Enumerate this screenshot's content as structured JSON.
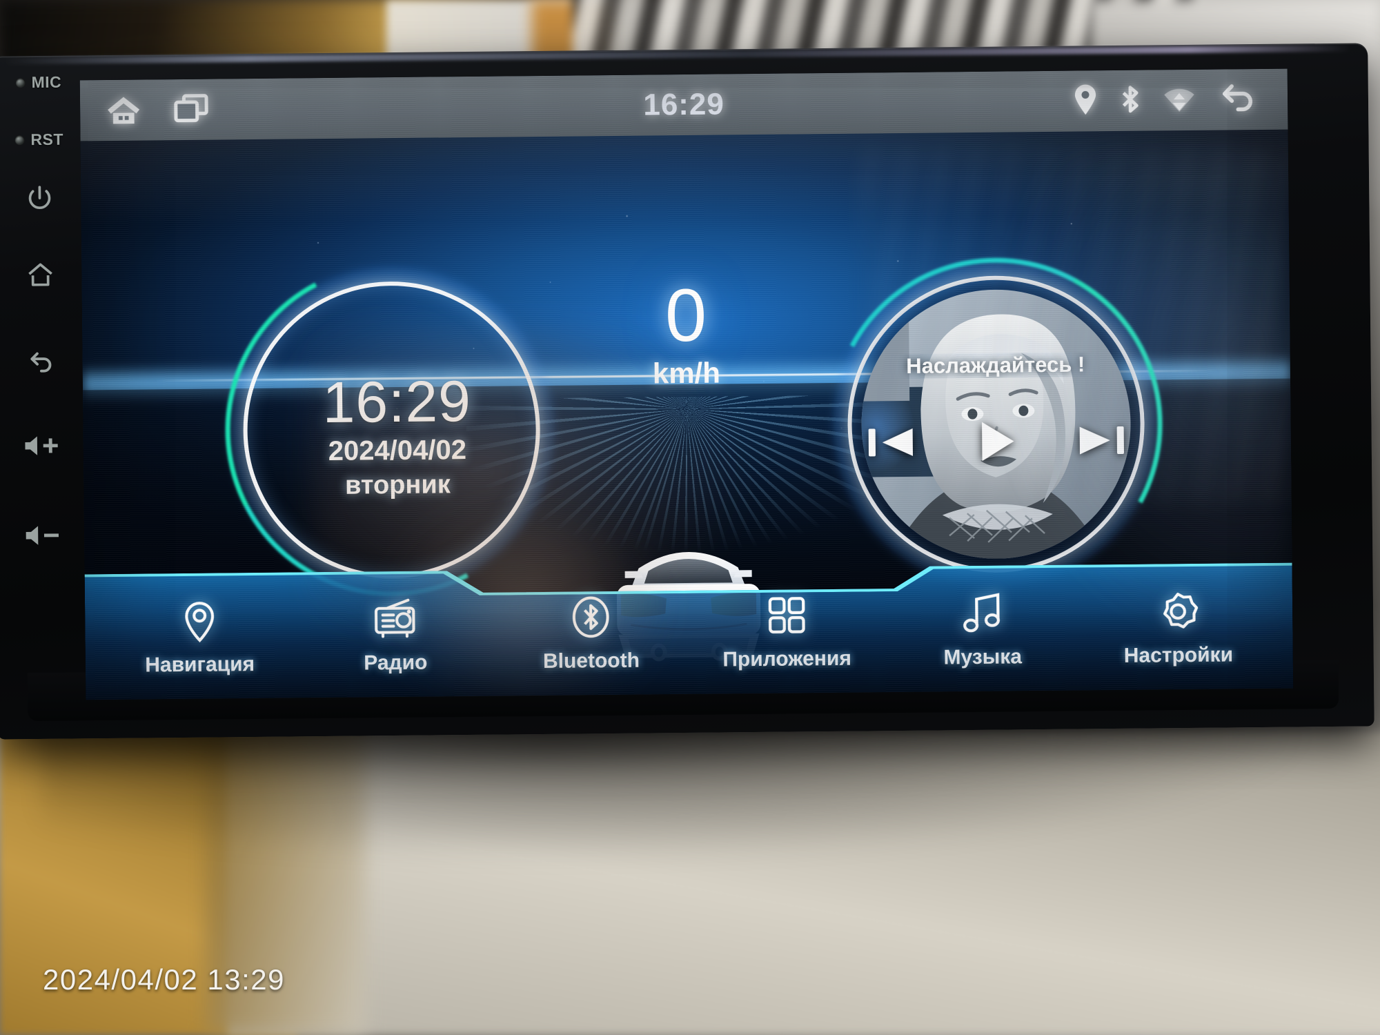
{
  "device": {
    "hardware_keys": [
      {
        "name": "mic",
        "label": "MIC",
        "type": "hole"
      },
      {
        "name": "reset",
        "label": "RST",
        "type": "hole"
      },
      {
        "name": "power",
        "label": "",
        "type": "icon"
      },
      {
        "name": "home",
        "label": "",
        "type": "icon"
      },
      {
        "name": "back",
        "label": "",
        "type": "icon"
      },
      {
        "name": "volume-up",
        "label": "+",
        "type": "icon"
      },
      {
        "name": "volume-down",
        "label": "−",
        "type": "icon"
      }
    ]
  },
  "statusbar": {
    "clock": "16:29",
    "left_icons": [
      "home-icon",
      "recents-icon"
    ],
    "right_icons": [
      "location-icon",
      "bluetooth-icon",
      "wifi-icon",
      "back-icon"
    ]
  },
  "home": {
    "clock_widget": {
      "time": "16:29",
      "date": "2024/04/02",
      "weekday": "вторник"
    },
    "speed_widget": {
      "value": "0",
      "unit": "km/h"
    },
    "music_widget": {
      "track_title": "Наслаждайтесь !",
      "controls": [
        "previous-icon",
        "play-icon",
        "next-icon"
      ]
    }
  },
  "dock": {
    "items": [
      {
        "label": "Навигация",
        "icon": "location-pin-icon"
      },
      {
        "label": "Радио",
        "icon": "radio-icon"
      },
      {
        "label": "Bluetooth",
        "icon": "bluetooth-icon"
      },
      {
        "label": "Приложения",
        "icon": "apps-grid-icon"
      },
      {
        "label": "Музыка",
        "icon": "music-note-icon"
      },
      {
        "label": "Настройки",
        "icon": "gear-icon"
      }
    ]
  },
  "photo": {
    "timestamp": "2024/04/02 13:29"
  },
  "colors": {
    "accent_cyan": "#6ff0ff",
    "ring_accent": "#19e6b4",
    "dock_blue": "#1b8ed6",
    "statusbar_gray": "#5d666d",
    "tail_light": "#f5a01e"
  }
}
